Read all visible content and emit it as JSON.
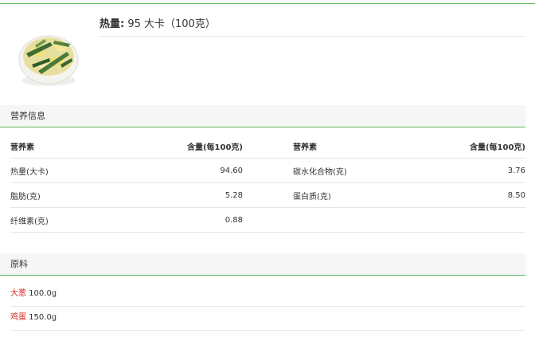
{
  "header": {
    "calorie_label": "热量:",
    "calorie_value": " 95 大卡（100克）"
  },
  "nutrition": {
    "section_title": "营养信息",
    "columns": {
      "name_header": "营养素",
      "value_header": "含量(每100克)"
    },
    "rows": [
      {
        "left_name": "热量(大卡)",
        "left_value": "94.60",
        "right_name": "碳水化合物(克)",
        "right_value": "3.76"
      },
      {
        "left_name": "脂肪(克)",
        "left_value": "5.28",
        "right_name": "蛋白质(克)",
        "right_value": "8.50"
      },
      {
        "left_name": "纤维素(克)",
        "left_value": "0.88",
        "right_name": "",
        "right_value": ""
      }
    ]
  },
  "ingredients": {
    "section_title": "原料",
    "items": [
      {
        "name": "大葱",
        "amount": " 100.0g"
      },
      {
        "name": "鸡蛋",
        "amount": " 150.0g"
      }
    ]
  },
  "colors": {
    "accent_green": "#5cb85c",
    "ingredient_red": "#d9251d",
    "section_bg": "#f6f6f6"
  }
}
